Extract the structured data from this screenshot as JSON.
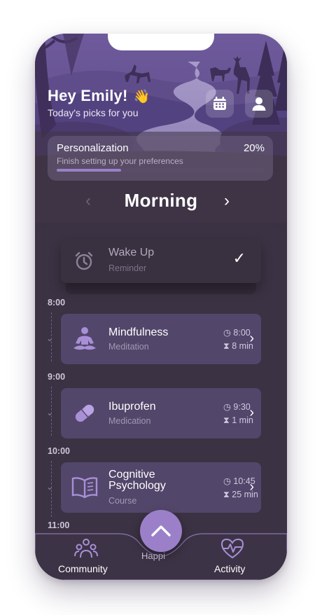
{
  "header": {
    "greeting": "Hey Emily!",
    "wave_emoji": "👋",
    "subtitle": "Today's picks for you",
    "calendar_icon": "calendar-icon",
    "profile_icon": "user-icon"
  },
  "personalization": {
    "title": "Personalization",
    "percent_label": "20%",
    "progress_fraction": 0.2,
    "subtitle": "Finish setting up your preferences"
  },
  "day_selector": {
    "prev_icon": "‹",
    "label": "Morning",
    "next_icon": "›"
  },
  "reminder": {
    "title": "Wake Up",
    "subtitle": "Reminder",
    "check_icon": "✓"
  },
  "schedule": [
    {
      "time": "8:00",
      "title": "Mindfulness",
      "subtitle": "Meditation",
      "start": "8:00",
      "duration": "8 min"
    },
    {
      "time": "9:00",
      "title": "Ibuprofen",
      "subtitle": "Medication",
      "start": "9:30",
      "duration": "1 min"
    },
    {
      "time": "10:00",
      "title": "Cognitive Psychology",
      "title_line1": "Cognitive",
      "title_line2": "Psychology",
      "subtitle": "Course",
      "start": "10:45",
      "duration": "25 min"
    },
    {
      "time": "11:00"
    }
  ],
  "bottom_nav": {
    "left_label": "Community",
    "middle_label": "Happi",
    "right_label": "Activity",
    "fab_icon": "chevron-up-icon"
  },
  "colors": {
    "background": "#3b3243",
    "accent": "#9b80c9",
    "card": "#52466a"
  }
}
